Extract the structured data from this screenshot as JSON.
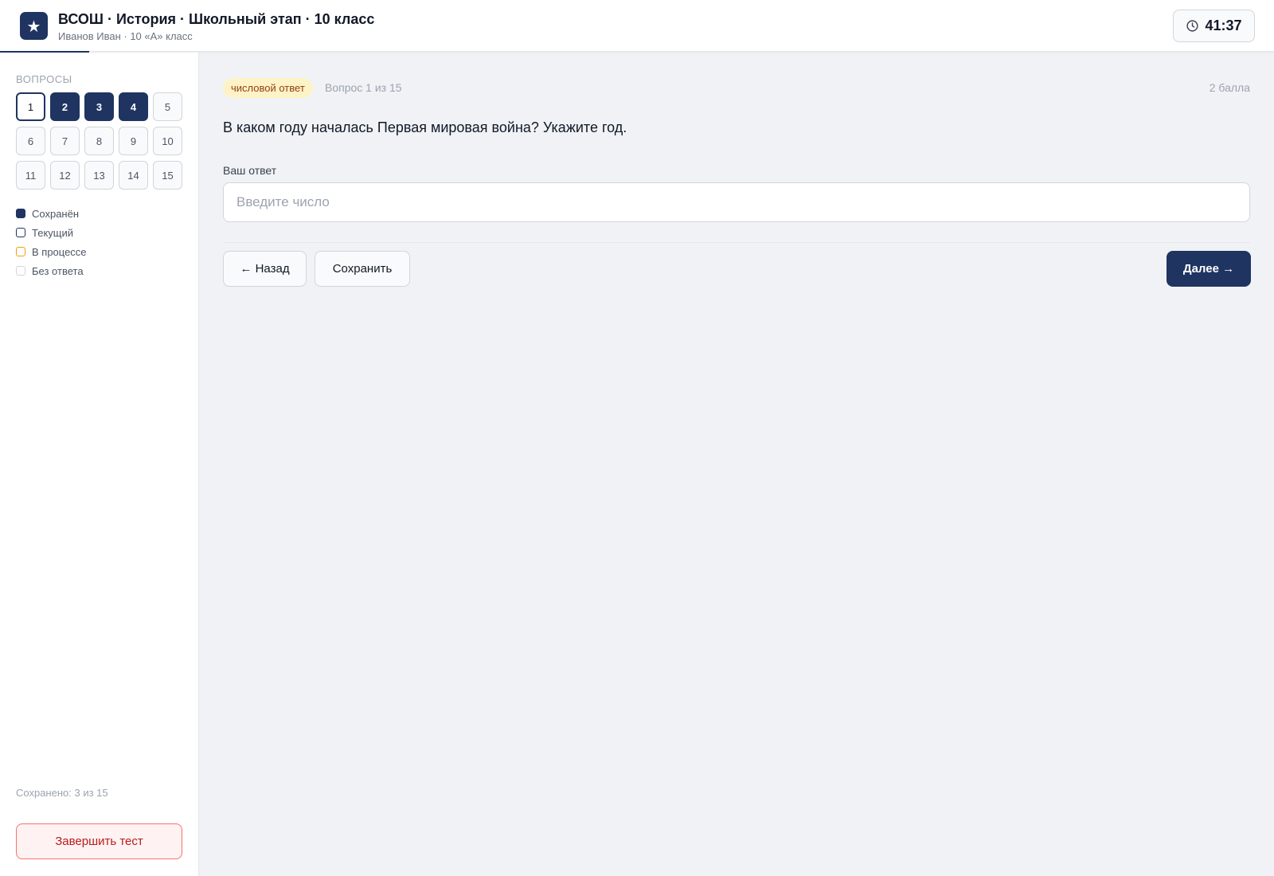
{
  "header": {
    "logo_glyph": "★",
    "title": "ВСОШ · История · Школьный этап · 10 класс",
    "subtitle": "Иванов Иван · 10 «А» класс",
    "timer": "41:37",
    "progress_fraction": 0.07
  },
  "sidebar": {
    "heading": "Вопросы",
    "questions": [
      {
        "label": "1",
        "state": "current"
      },
      {
        "label": "2",
        "state": "saved"
      },
      {
        "label": "3",
        "state": "saved"
      },
      {
        "label": "4",
        "state": "saved"
      },
      {
        "label": "5",
        "state": "empty"
      },
      {
        "label": "6",
        "state": "empty"
      },
      {
        "label": "7",
        "state": "empty"
      },
      {
        "label": "8",
        "state": "empty"
      },
      {
        "label": "9",
        "state": "empty"
      },
      {
        "label": "10",
        "state": "empty"
      },
      {
        "label": "11",
        "state": "empty"
      },
      {
        "label": "12",
        "state": "empty"
      },
      {
        "label": "13",
        "state": "empty"
      },
      {
        "label": "14",
        "state": "empty"
      },
      {
        "label": "15",
        "state": "empty"
      }
    ],
    "legend": [
      {
        "label": "Сохранён",
        "kind": "saved"
      },
      {
        "label": "Текущий",
        "kind": "current"
      },
      {
        "label": "В процессе",
        "kind": "progress"
      },
      {
        "label": "Без ответа",
        "kind": "empty"
      }
    ],
    "saved_count": "Сохранено: 3 из 15",
    "finish_label": "Завершить тест"
  },
  "main": {
    "badge": "числовой ответ",
    "question_number": "Вопрос 1 из 15",
    "points": "2 балла",
    "question_text": "В каком году началась Первая мировая война? Укажите год.",
    "answer_label": "Ваш ответ",
    "answer_value": "",
    "answer_placeholder": "Введите число",
    "back_label": "← Назад",
    "save_label": "Сохранить",
    "next_label": "Далее →"
  },
  "colors": {
    "primary": "#1f3461",
    "badge_bg": "#fef3c7",
    "badge_text": "#92400e",
    "danger": "#b91c1c",
    "progress_legend": "#f59e0b"
  }
}
